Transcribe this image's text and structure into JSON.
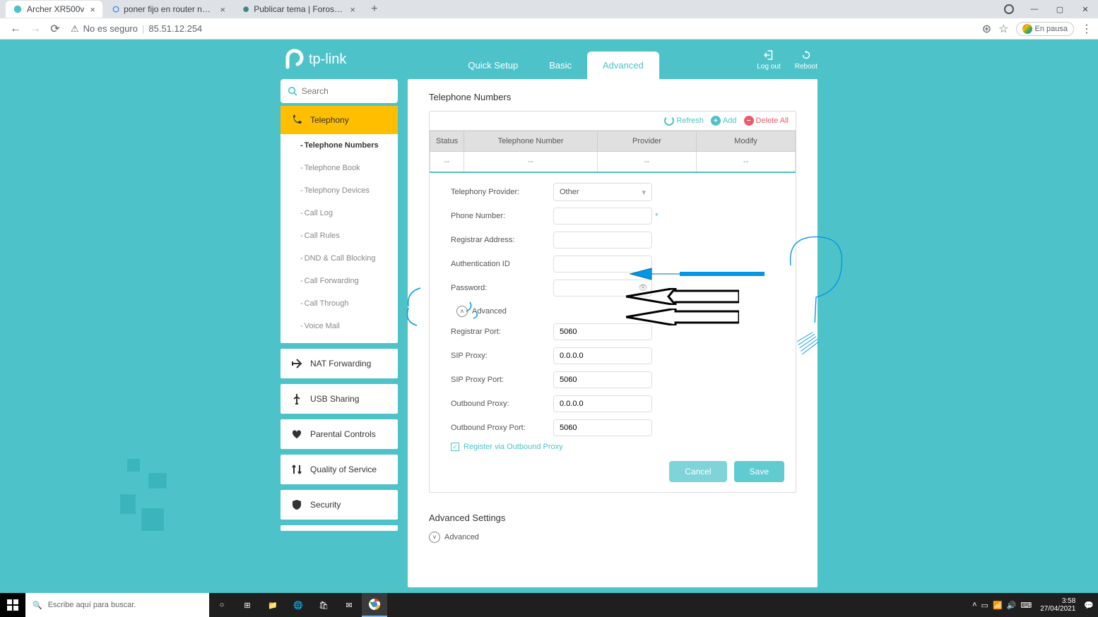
{
  "browser": {
    "tabs": [
      {
        "label": "Archer XR500v",
        "active": true
      },
      {
        "label": "poner fijo en router neutro oran…",
        "active": false
      },
      {
        "label": "Publicar tema | Foros ADSLZone",
        "active": false
      }
    ],
    "url_security": "No es seguro",
    "url": "85.51.12.254",
    "pause_label": "En pausa"
  },
  "header": {
    "brand": "tp-link",
    "nav": {
      "quick": "Quick Setup",
      "basic": "Basic",
      "advanced": "Advanced"
    },
    "logout": "Log out",
    "reboot": "Reboot"
  },
  "search": {
    "placeholder": "Search"
  },
  "sidebar": {
    "telephony": {
      "label": "Telephony",
      "items": [
        "Telephone Numbers",
        "Telephone Book",
        "Telephony Devices",
        "Call Log",
        "Call Rules",
        "DND & Call Blocking",
        "Call Forwarding",
        "Call Through",
        "Voice Mail"
      ]
    },
    "other": {
      "nat": "NAT Forwarding",
      "usb": "USB Sharing",
      "parental": "Parental Controls",
      "qos": "Quality of Service",
      "security": "Security"
    }
  },
  "content": {
    "title": "Telephone Numbers",
    "actions": {
      "refresh": "Refresh",
      "add": "Add",
      "delete_all": "Delete All"
    },
    "table": {
      "headers": {
        "status": "Status",
        "number": "Telephone Number",
        "provider": "Provider",
        "modify": "Modify"
      },
      "empty": "--"
    },
    "form": {
      "provider_label": "Telephony Provider:",
      "provider_value": "Other",
      "phone_label": "Phone Number:",
      "phone_value": "",
      "registrar_label": "Registrar Address:",
      "registrar_value": "",
      "auth_label": "Authentication ID",
      "auth_value": "",
      "password_label": "Password:",
      "password_value": "",
      "advanced_toggle": "Advanced",
      "reg_port_label": "Registrar Port:",
      "reg_port_value": "5060",
      "sip_proxy_label": "SIP Proxy:",
      "sip_proxy_value": "0.0.0.0",
      "sip_port_label": "SIP Proxy Port:",
      "sip_port_value": "5060",
      "out_proxy_label": "Outbound Proxy:",
      "out_proxy_value": "0.0.0.0",
      "out_port_label": "Outbound Proxy Port:",
      "out_port_value": "5060",
      "register_cb": "Register via Outbound Proxy",
      "cancel": "Cancel",
      "save": "Save"
    },
    "adv_settings_title": "Advanced Settings",
    "adv_toggle2": "Advanced"
  },
  "taskbar": {
    "search_placeholder": "Escribe aquí para buscar.",
    "time": "3:58",
    "date": "27/04/2021"
  }
}
